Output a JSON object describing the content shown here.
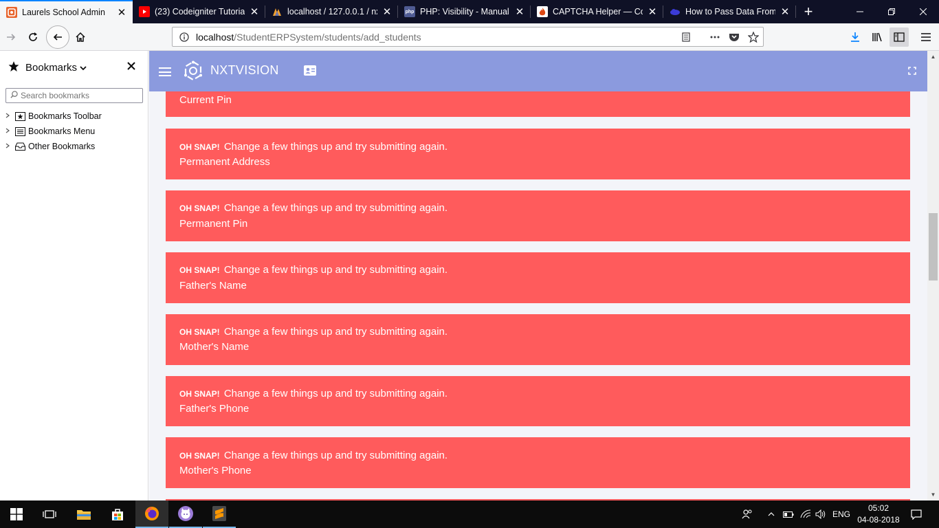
{
  "browser": {
    "tabs": [
      {
        "title": "Laurels School Admin",
        "favicon": "codeigniter-icon",
        "active": true
      },
      {
        "title": "(23) Codeigniter Tutorial",
        "favicon": "youtube-icon",
        "active": false
      },
      {
        "title": "localhost / 127.0.0.1 / nxt",
        "favicon": "phpmyadmin-icon",
        "active": false
      },
      {
        "title": "PHP: Visibility - Manual",
        "favicon": "php-icon",
        "active": false
      },
      {
        "title": "CAPTCHA Helper — Cod",
        "favicon": "codeigniter-flame-icon",
        "active": false
      },
      {
        "title": "How to Pass Data From C",
        "favicon": "cloud-icon",
        "active": false
      }
    ],
    "url": {
      "host": "localhost",
      "path": "/StudentERPSystem/students/add_students"
    }
  },
  "sidebar": {
    "title": "Bookmarks",
    "search_placeholder": "Search bookmarks",
    "items": [
      {
        "label": "Bookmarks Toolbar"
      },
      {
        "label": "Bookmarks Menu"
      },
      {
        "label": "Other Bookmarks"
      }
    ]
  },
  "app": {
    "brand": "NXTVISION",
    "header_color": "#8b9ade"
  },
  "alerts": {
    "prefix": "OH SNAP!",
    "message": "Change a few things up and try submitting again.",
    "alert_color": "#ff5b5c",
    "partial_top_label": "Current Pin",
    "items": [
      {
        "field": "Permanent Address"
      },
      {
        "field": "Permanent Pin"
      },
      {
        "field": "Father's Name"
      },
      {
        "field": "Mother's Name"
      },
      {
        "field": "Father's Phone"
      },
      {
        "field": "Mother's Phone"
      }
    ]
  },
  "taskbar": {
    "language": "ENG",
    "time": "05:02",
    "date": "04-08-2018"
  }
}
